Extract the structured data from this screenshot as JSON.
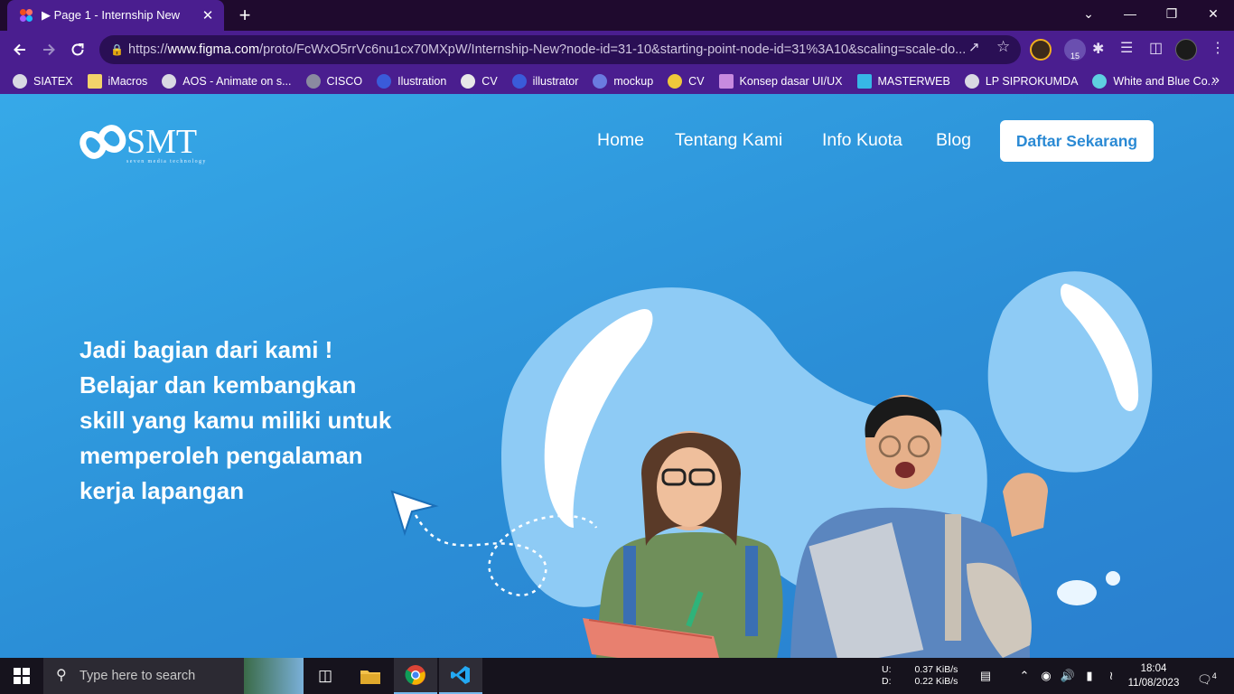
{
  "browser": {
    "tab": {
      "title": "▶ Page 1 - Internship New",
      "close": "✕"
    },
    "new_tab": "+",
    "url_prefix": "https://",
    "url_host": "www.figma.com",
    "url_path": "/proto/FcWxO5rrVc6nu1cx70MXpW/Internship-New?node-id=31-10&starting-point-node-id=31%3A10&scaling=scale-do...",
    "extension_badge": "15",
    "window_controls": {
      "minimize": "—",
      "restore": "❐",
      "close": "✕",
      "tabs_menu": "⌄"
    }
  },
  "bookmarks": [
    {
      "label": "SIATEX",
      "icon": "globe-icon",
      "color": "#d9d9e3"
    },
    {
      "label": "iMacros",
      "icon": "note-icon",
      "color": "#f3d36a"
    },
    {
      "label": "AOS - Animate on s...",
      "icon": "globe-icon",
      "color": "#d9d9e3"
    },
    {
      "label": "CISCO",
      "icon": "cisco-icon",
      "color": "#8a8aa0"
    },
    {
      "label": "Ilustration",
      "icon": "s-icon",
      "color": "#3a5bd9"
    },
    {
      "label": "CV",
      "icon": "rx-icon",
      "color": "#e8e8e8"
    },
    {
      "label": "illustrator",
      "icon": "s-icon",
      "color": "#3a5bd9"
    },
    {
      "label": "mockup",
      "icon": "cube-icon",
      "color": "#6a7be0"
    },
    {
      "label": "CV",
      "icon": "spark-icon",
      "color": "#f0c93a"
    },
    {
      "label": "Konsep dasar UI/UX",
      "icon": "doc-icon",
      "color": "#c78adf"
    },
    {
      "label": "MASTERWEB",
      "icon": "book-icon",
      "color": "#37b7e6"
    },
    {
      "label": "LP SIPROKUMDA",
      "icon": "globe-icon",
      "color": "#d9d9e3"
    },
    {
      "label": "White and Blue Co...",
      "icon": "canva-icon",
      "color": "#5ed0e0"
    }
  ],
  "site": {
    "logo_text": "SMT",
    "logo_tagline": "seven media technology",
    "nav": [
      "Home",
      "Tentang Kami",
      "Info Kuota",
      "Blog"
    ],
    "cta": "Daftar Sekarang",
    "hero_lines": [
      "Jadi bagian dari kami !",
      "Belajar dan kembangkan",
      "skill yang kamu miliki untuk",
      "memperoleh pengalaman",
      "kerja lapangan"
    ]
  },
  "taskbar": {
    "search_placeholder": "Type here to search",
    "net_upload_label": "U:",
    "net_upload_value": "0.37 KiB/s",
    "net_download_label": "D:",
    "net_download_value": "0.22 KiB/s",
    "time": "18:04",
    "date": "11/08/2023",
    "notifications": "4"
  },
  "colors": {
    "browser_frame": "#4a1e8f",
    "page_bg": "#2b8fd7",
    "cta_text": "#2b8ad4",
    "blob": "#8ecbf5"
  }
}
